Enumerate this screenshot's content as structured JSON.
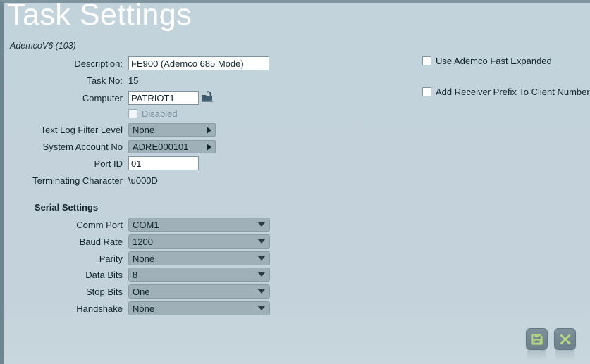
{
  "window": {
    "title": "Task Settings",
    "subtitle": "AdemcoV6 (103)"
  },
  "colors": {
    "background": "#c3d3db",
    "title_text": "#ffffff",
    "label_text": "#12242e",
    "control_fill": "#9fb0b9",
    "input_fill": "#ffffff",
    "button_fill": "#768993",
    "button_icon": "#b4d77f",
    "left_border": "#6d8692",
    "top_border": "#7e959f"
  },
  "form": {
    "description": {
      "label": "Description:",
      "value": "FE900 (Ademco 685 Mode)"
    },
    "task_no": {
      "label": "Task No:",
      "value": "15"
    },
    "computer": {
      "label": "Computer",
      "value": "PATRIOT1",
      "browse_icon": "folder-browse-icon"
    },
    "disabled": {
      "label": "Disabled",
      "checked": false
    },
    "text_log_filter_level": {
      "label": "Text Log Filter Level",
      "value": "None"
    },
    "system_account_no": {
      "label": "System Account No",
      "value": "ADRE000101"
    },
    "port_id": {
      "label": "Port ID",
      "value": "01"
    },
    "terminating_character": {
      "label": "Terminating Character",
      "value": "\\u000D"
    }
  },
  "options": {
    "use_ademco_fast_expanded": {
      "label": "Use Ademco Fast Expanded",
      "checked": false
    },
    "add_receiver_prefix": {
      "label": "Add Receiver Prefix To Client Number",
      "checked": false
    }
  },
  "serial": {
    "heading": "Serial Settings",
    "fields": [
      {
        "label": "Comm Port",
        "value": "COM1"
      },
      {
        "label": "Baud Rate",
        "value": "1200"
      },
      {
        "label": "Parity",
        "value": "None"
      },
      {
        "label": "Data Bits",
        "value": "8"
      },
      {
        "label": "Stop Bits",
        "value": "One"
      },
      {
        "label": "Handshake",
        "value": "None"
      }
    ]
  },
  "actions": {
    "save": {
      "name": "save-button",
      "icon": "floppy-disk-icon"
    },
    "cancel": {
      "name": "cancel-button",
      "icon": "close-x-icon"
    }
  }
}
